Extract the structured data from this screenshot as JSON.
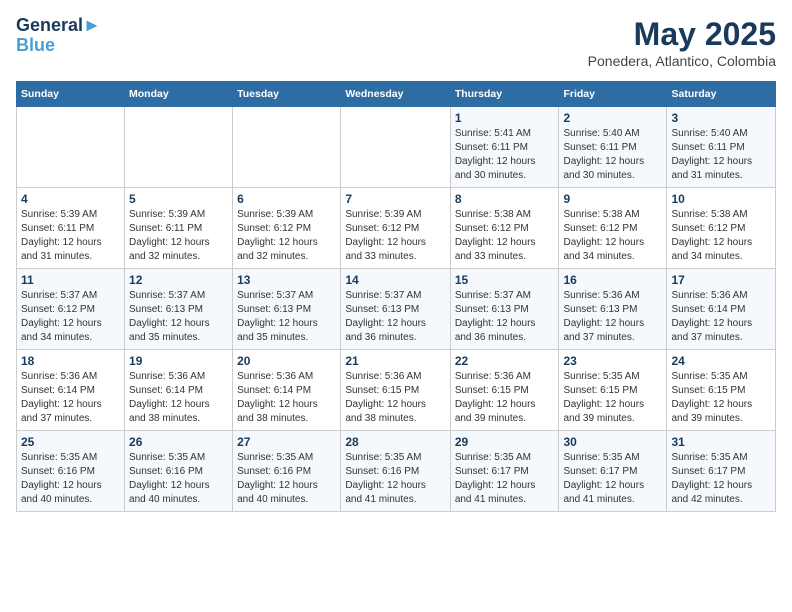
{
  "header": {
    "logo_line1": "General",
    "logo_line2": "Blue",
    "month_year": "May 2025",
    "location": "Ponedera, Atlantico, Colombia"
  },
  "days_of_week": [
    "Sunday",
    "Monday",
    "Tuesday",
    "Wednesday",
    "Thursday",
    "Friday",
    "Saturday"
  ],
  "weeks": [
    [
      {
        "num": "",
        "info": ""
      },
      {
        "num": "",
        "info": ""
      },
      {
        "num": "",
        "info": ""
      },
      {
        "num": "",
        "info": ""
      },
      {
        "num": "1",
        "info": "Sunrise: 5:41 AM\nSunset: 6:11 PM\nDaylight: 12 hours\nand 30 minutes."
      },
      {
        "num": "2",
        "info": "Sunrise: 5:40 AM\nSunset: 6:11 PM\nDaylight: 12 hours\nand 30 minutes."
      },
      {
        "num": "3",
        "info": "Sunrise: 5:40 AM\nSunset: 6:11 PM\nDaylight: 12 hours\nand 31 minutes."
      }
    ],
    [
      {
        "num": "4",
        "info": "Sunrise: 5:39 AM\nSunset: 6:11 PM\nDaylight: 12 hours\nand 31 minutes."
      },
      {
        "num": "5",
        "info": "Sunrise: 5:39 AM\nSunset: 6:11 PM\nDaylight: 12 hours\nand 32 minutes."
      },
      {
        "num": "6",
        "info": "Sunrise: 5:39 AM\nSunset: 6:12 PM\nDaylight: 12 hours\nand 32 minutes."
      },
      {
        "num": "7",
        "info": "Sunrise: 5:39 AM\nSunset: 6:12 PM\nDaylight: 12 hours\nand 33 minutes."
      },
      {
        "num": "8",
        "info": "Sunrise: 5:38 AM\nSunset: 6:12 PM\nDaylight: 12 hours\nand 33 minutes."
      },
      {
        "num": "9",
        "info": "Sunrise: 5:38 AM\nSunset: 6:12 PM\nDaylight: 12 hours\nand 34 minutes."
      },
      {
        "num": "10",
        "info": "Sunrise: 5:38 AM\nSunset: 6:12 PM\nDaylight: 12 hours\nand 34 minutes."
      }
    ],
    [
      {
        "num": "11",
        "info": "Sunrise: 5:37 AM\nSunset: 6:12 PM\nDaylight: 12 hours\nand 34 minutes."
      },
      {
        "num": "12",
        "info": "Sunrise: 5:37 AM\nSunset: 6:13 PM\nDaylight: 12 hours\nand 35 minutes."
      },
      {
        "num": "13",
        "info": "Sunrise: 5:37 AM\nSunset: 6:13 PM\nDaylight: 12 hours\nand 35 minutes."
      },
      {
        "num": "14",
        "info": "Sunrise: 5:37 AM\nSunset: 6:13 PM\nDaylight: 12 hours\nand 36 minutes."
      },
      {
        "num": "15",
        "info": "Sunrise: 5:37 AM\nSunset: 6:13 PM\nDaylight: 12 hours\nand 36 minutes."
      },
      {
        "num": "16",
        "info": "Sunrise: 5:36 AM\nSunset: 6:13 PM\nDaylight: 12 hours\nand 37 minutes."
      },
      {
        "num": "17",
        "info": "Sunrise: 5:36 AM\nSunset: 6:14 PM\nDaylight: 12 hours\nand 37 minutes."
      }
    ],
    [
      {
        "num": "18",
        "info": "Sunrise: 5:36 AM\nSunset: 6:14 PM\nDaylight: 12 hours\nand 37 minutes."
      },
      {
        "num": "19",
        "info": "Sunrise: 5:36 AM\nSunset: 6:14 PM\nDaylight: 12 hours\nand 38 minutes."
      },
      {
        "num": "20",
        "info": "Sunrise: 5:36 AM\nSunset: 6:14 PM\nDaylight: 12 hours\nand 38 minutes."
      },
      {
        "num": "21",
        "info": "Sunrise: 5:36 AM\nSunset: 6:15 PM\nDaylight: 12 hours\nand 38 minutes."
      },
      {
        "num": "22",
        "info": "Sunrise: 5:36 AM\nSunset: 6:15 PM\nDaylight: 12 hours\nand 39 minutes."
      },
      {
        "num": "23",
        "info": "Sunrise: 5:35 AM\nSunset: 6:15 PM\nDaylight: 12 hours\nand 39 minutes."
      },
      {
        "num": "24",
        "info": "Sunrise: 5:35 AM\nSunset: 6:15 PM\nDaylight: 12 hours\nand 39 minutes."
      }
    ],
    [
      {
        "num": "25",
        "info": "Sunrise: 5:35 AM\nSunset: 6:16 PM\nDaylight: 12 hours\nand 40 minutes."
      },
      {
        "num": "26",
        "info": "Sunrise: 5:35 AM\nSunset: 6:16 PM\nDaylight: 12 hours\nand 40 minutes."
      },
      {
        "num": "27",
        "info": "Sunrise: 5:35 AM\nSunset: 6:16 PM\nDaylight: 12 hours\nand 40 minutes."
      },
      {
        "num": "28",
        "info": "Sunrise: 5:35 AM\nSunset: 6:16 PM\nDaylight: 12 hours\nand 41 minutes."
      },
      {
        "num": "29",
        "info": "Sunrise: 5:35 AM\nSunset: 6:17 PM\nDaylight: 12 hours\nand 41 minutes."
      },
      {
        "num": "30",
        "info": "Sunrise: 5:35 AM\nSunset: 6:17 PM\nDaylight: 12 hours\nand 41 minutes."
      },
      {
        "num": "31",
        "info": "Sunrise: 5:35 AM\nSunset: 6:17 PM\nDaylight: 12 hours\nand 42 minutes."
      }
    ]
  ]
}
